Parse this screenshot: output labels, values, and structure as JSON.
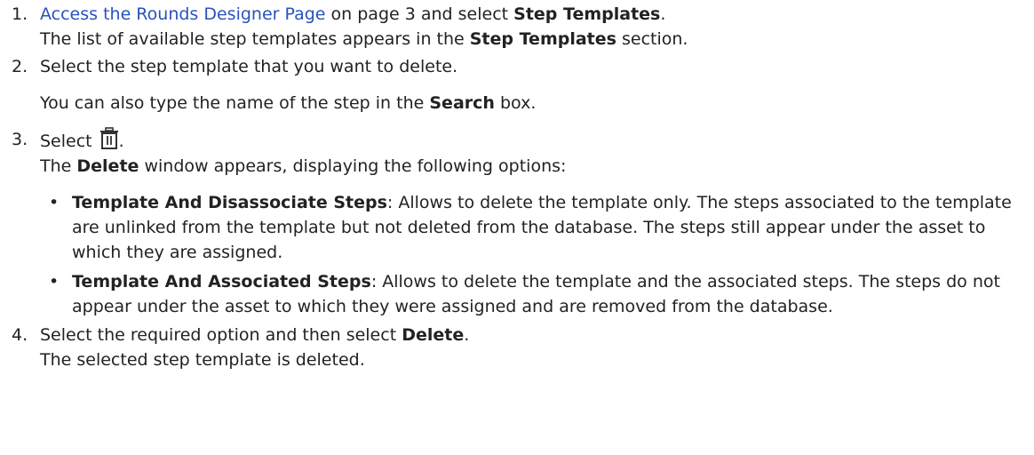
{
  "steps": [
    {
      "num": "1.",
      "line1": {
        "link": "Access the Rounds Designer Page",
        "mid": " on page 3 and select ",
        "bold": "Step Templates",
        "end": "."
      },
      "line2": {
        "pre": "The list of available step templates appears in the ",
        "bold": "Step Templates",
        "end": " section."
      }
    },
    {
      "num": "2.",
      "text": "Select the step template that you want to delete.",
      "note": {
        "pre": "You can also type the name of the step in the ",
        "bold": "Search",
        "end": " box."
      }
    },
    {
      "num": "3.",
      "pre": "Select ",
      "icon": "trash-icon",
      "end": ".",
      "line2": {
        "pre": "The ",
        "bold": "Delete",
        "end": " window appears, displaying the following options:"
      },
      "options": [
        {
          "bullet": "•",
          "title": "Template And Disassociate Steps",
          "text": ": Allows to delete the template only. The steps associated to the template are unlinked from the template but not deleted from the database. The steps still appear under the asset to which they are assigned."
        },
        {
          "bullet": "•",
          "title": "Template And Associated Steps",
          "text": ": Allows to delete the template and the associated steps. The steps do not appear under the asset to which they were assigned and are removed from the database."
        }
      ]
    },
    {
      "num": "4.",
      "line1": {
        "pre": "Select the required option and then select ",
        "bold": "Delete",
        "end": "."
      },
      "line2": "The selected step template is deleted."
    }
  ],
  "colors": {
    "link": "#2a52be",
    "text": "#222222"
  }
}
